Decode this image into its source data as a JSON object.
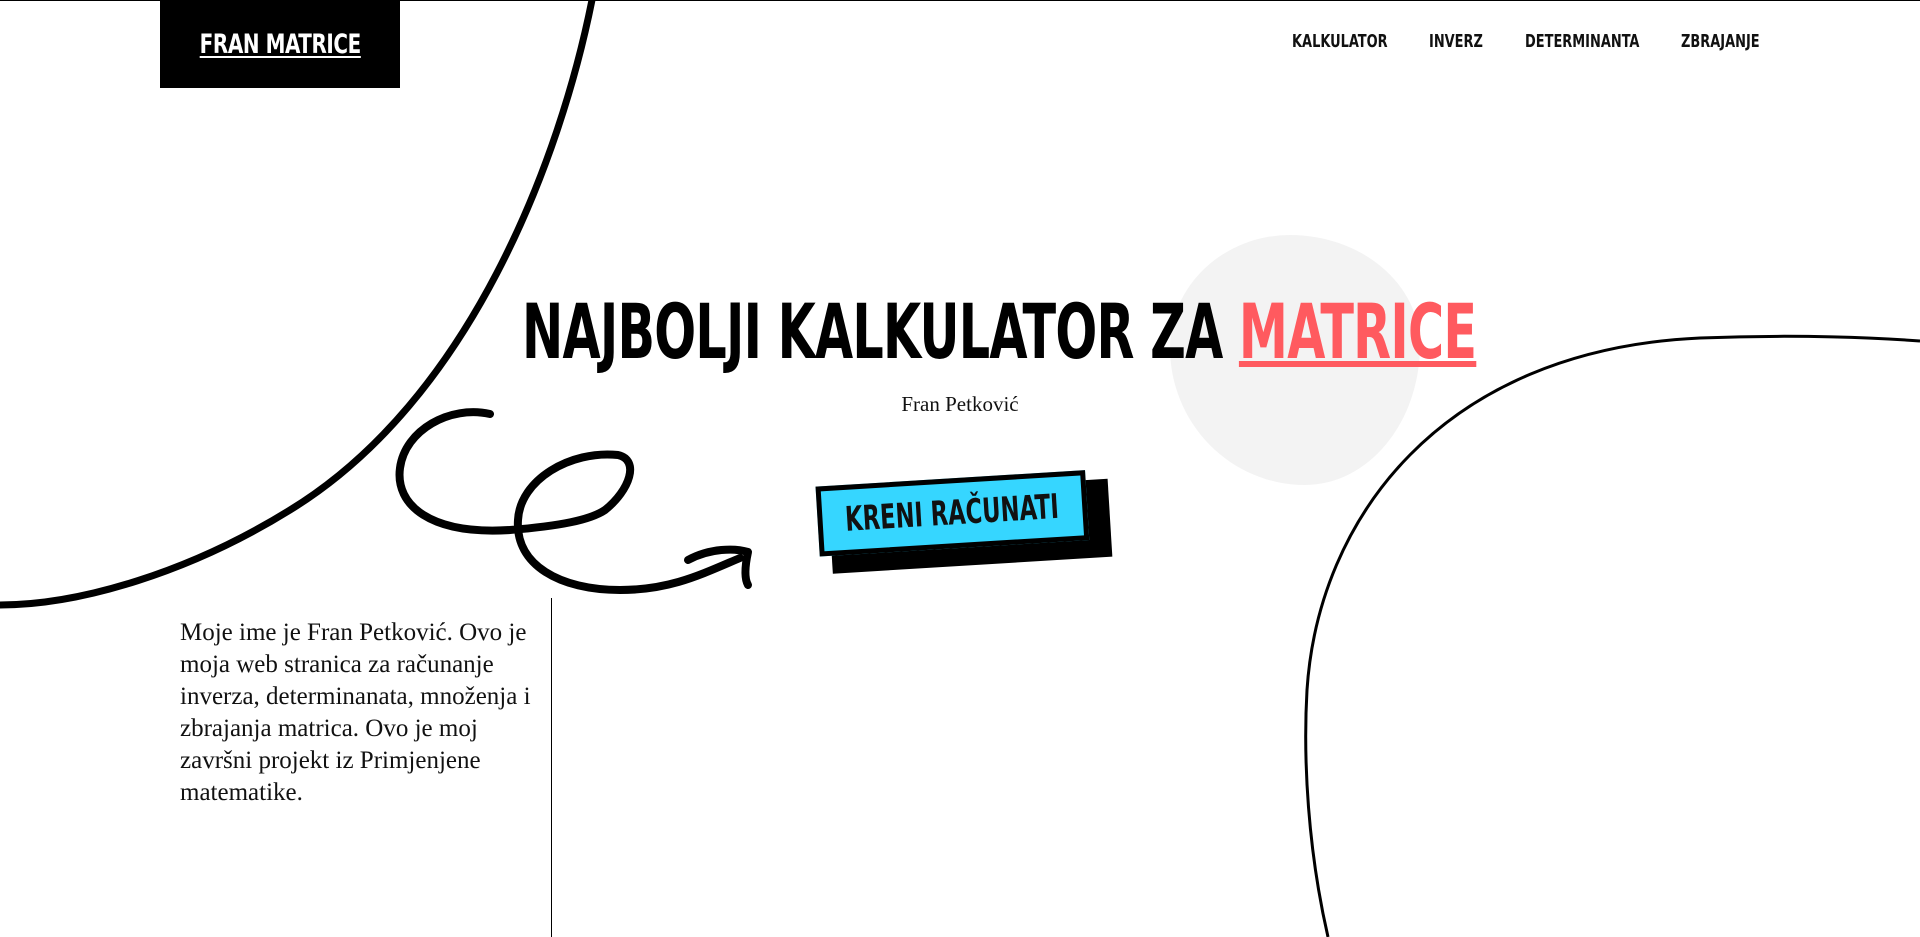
{
  "header": {
    "logo_text": "FRAN MATRICE",
    "nav": [
      {
        "label": "KALKULATOR"
      },
      {
        "label": "INVERZ"
      },
      {
        "label": "DETERMINANTA"
      },
      {
        "label": "ZBRAJANJE"
      }
    ]
  },
  "hero": {
    "title_main": "NAJBOLJI KALKULATOR ZA ",
    "title_accent": "MATRICE",
    "subtitle": "Fran Petković",
    "cta_label": "KRENI RAČUNATI"
  },
  "about": {
    "text": "Moje ime je Fran Petković. Ovo je moja web stranica za računanje inverza, determinanata, množenja i zbrajanja matrica. Ovo je moj završni projekt iz Primjenjene matematike."
  },
  "colors": {
    "accent": "#ff5a5f",
    "cta": "#36d6ff",
    "blob": "#f3f3f3",
    "ink": "#000000"
  },
  "icons": {
    "scribble_arrow": "scribble-arrow-icon"
  }
}
